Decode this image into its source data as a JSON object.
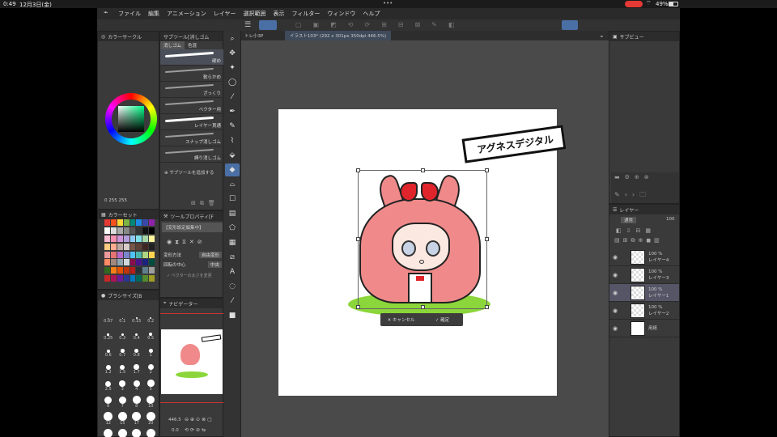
{
  "status": {
    "time": "0:49",
    "date": "12月3日(金)",
    "battery": "49%",
    "dots": "•••"
  },
  "menu": [
    "ファイル",
    "編集",
    "アニメーション",
    "レイヤー",
    "選択範囲",
    "表示",
    "フィルター",
    "ウィンドウ",
    "ヘルプ"
  ],
  "color_circle": {
    "title": "カラーサークル",
    "values": "0 255 255"
  },
  "subtool": {
    "tab_eraser": "消しゴム",
    "tab_color": "色混",
    "items": [
      "硬め",
      "軟らかめ",
      "ざっくり",
      "ベクター用",
      "レイヤー貫通",
      "スナップ消しゴム",
      "縛り消しゴム"
    ],
    "add": "サブツールを追加する"
  },
  "tool_property": {
    "title": "ツールプロパティ[F",
    "preset": "【変形設定編集中】",
    "rows": [
      {
        "label": "変形方法",
        "value": "自由変形"
      },
      {
        "label": "回転の中心",
        "value": "中央"
      }
    ],
    "check": "ベクターの太さを変更"
  },
  "color_set": {
    "title": "カラーセット"
  },
  "brush_size": {
    "title": "ブラシサイズ[B",
    "sizes": [
      "0.07",
      "0.1",
      "0.15",
      "0.2",
      "0.25",
      "0.3",
      "0.4",
      "0.5",
      "0.6",
      "0.7",
      "0.8",
      "1",
      "1.2",
      "1.5",
      "1.7",
      "2",
      "2.5",
      "3",
      "4",
      "5",
      "6",
      "7",
      "8",
      "10",
      "12",
      "15",
      "17",
      "20",
      "25",
      "30",
      "40",
      "50"
    ]
  },
  "navigator": {
    "title": "ナビゲーター",
    "zoom": "446.5",
    "rotate": "0.0"
  },
  "canvas_tab": {
    "title": "イラスト103* (292 x 301px 350dpi 446.5%)",
    "small_tab": "トレ小3P"
  },
  "artwork": {
    "banner_text": "アグネスデジタル"
  },
  "transform": {
    "cancel": "キャンセル",
    "confirm": "確定"
  },
  "subview": {
    "title": "サブビュー"
  },
  "layers": {
    "title": "レイヤー",
    "blend": "通常",
    "opacity": "100",
    "rows": [
      {
        "pct": "100 %",
        "mode": "通",
        "name": "レイヤー4"
      },
      {
        "pct": "100 %",
        "mode": "通",
        "name": "レイヤー3"
      },
      {
        "pct": "100 %",
        "mode": "通",
        "name": "レイヤー1"
      },
      {
        "pct": "100 %",
        "mode": "通",
        "name": "レイヤー2"
      },
      {
        "pct": "",
        "mode": "",
        "name": "用紙"
      }
    ]
  },
  "colors": {
    "accent": "#4a90d9",
    "red_btn": "#e53935",
    "grass": "#8bd63a",
    "hair": "#f08a8a",
    "bow": "#e0242c"
  }
}
